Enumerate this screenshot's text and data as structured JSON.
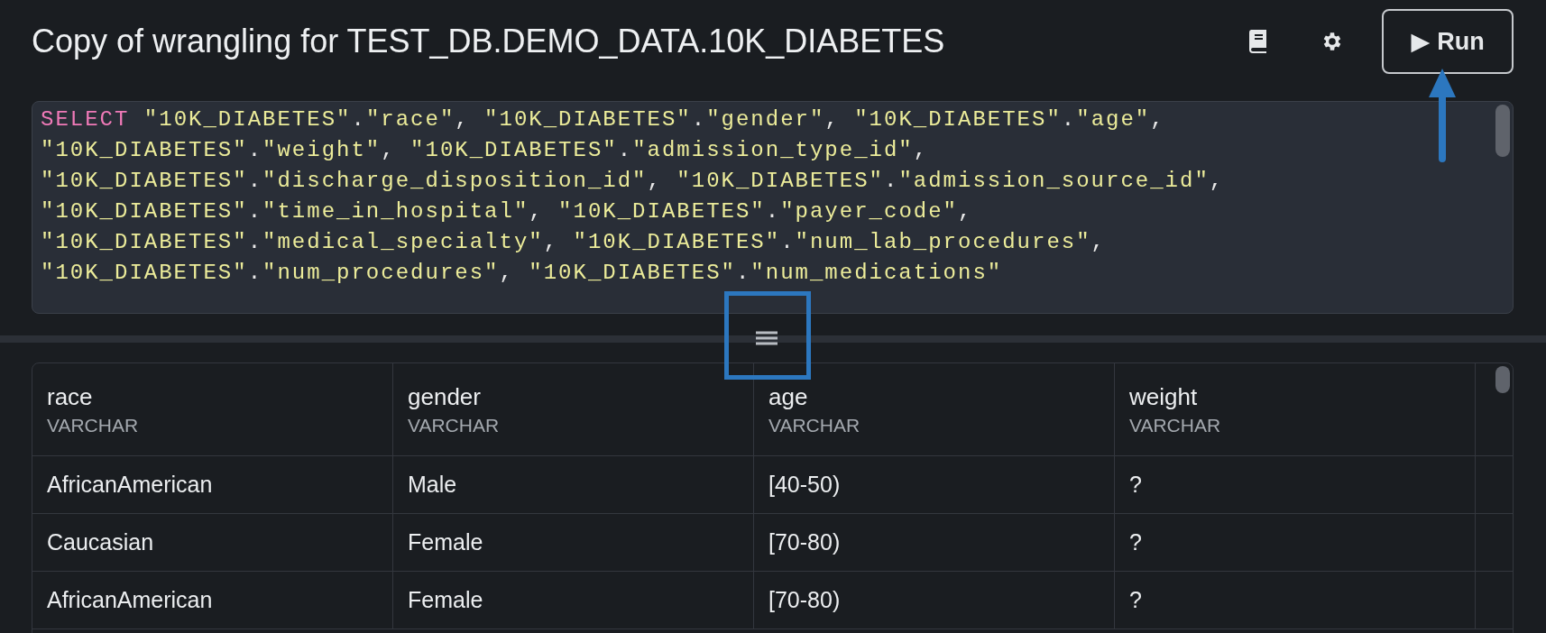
{
  "header": {
    "title": "Copy of wrangling for TEST_DB.DEMO_DATA.10K_DIABETES",
    "run_button": {
      "icon": "▶",
      "label": "Run"
    }
  },
  "editor": {
    "lines": [
      {
        "keyword": "SELECT",
        "text": " \"10K_DIABETES\".\"race\", \"10K_DIABETES\".\"gender\", \"10K_DIABETES\".\"age\","
      },
      {
        "text": "\"10K_DIABETES\".\"weight\", \"10K_DIABETES\".\"admission_type_id\","
      },
      {
        "text": "\"10K_DIABETES\".\"discharge_disposition_id\", \"10K_DIABETES\".\"admission_source_id\","
      },
      {
        "text": "\"10K_DIABETES\".\"time_in_hospital\", \"10K_DIABETES\".\"payer_code\","
      },
      {
        "text": "\"10K_DIABETES\".\"medical_specialty\", \"10K_DIABETES\".\"num_lab_procedures\","
      },
      {
        "text": "\"10K_DIABETES\".\"num_procedures\", \"10K_DIABETES\".\"num_medications\""
      }
    ]
  },
  "table": {
    "columns": [
      {
        "name": "race",
        "type": "VARCHAR"
      },
      {
        "name": "gender",
        "type": "VARCHAR"
      },
      {
        "name": "age",
        "type": "VARCHAR"
      },
      {
        "name": "weight",
        "type": "VARCHAR"
      }
    ],
    "rows": [
      [
        "AfricanAmerican",
        "Male",
        "[40-50)",
        "?"
      ],
      [
        "Caucasian",
        "Female",
        "[70-80)",
        "?"
      ],
      [
        "AfricanAmerican",
        "Female",
        "[70-80)",
        "?"
      ]
    ]
  }
}
